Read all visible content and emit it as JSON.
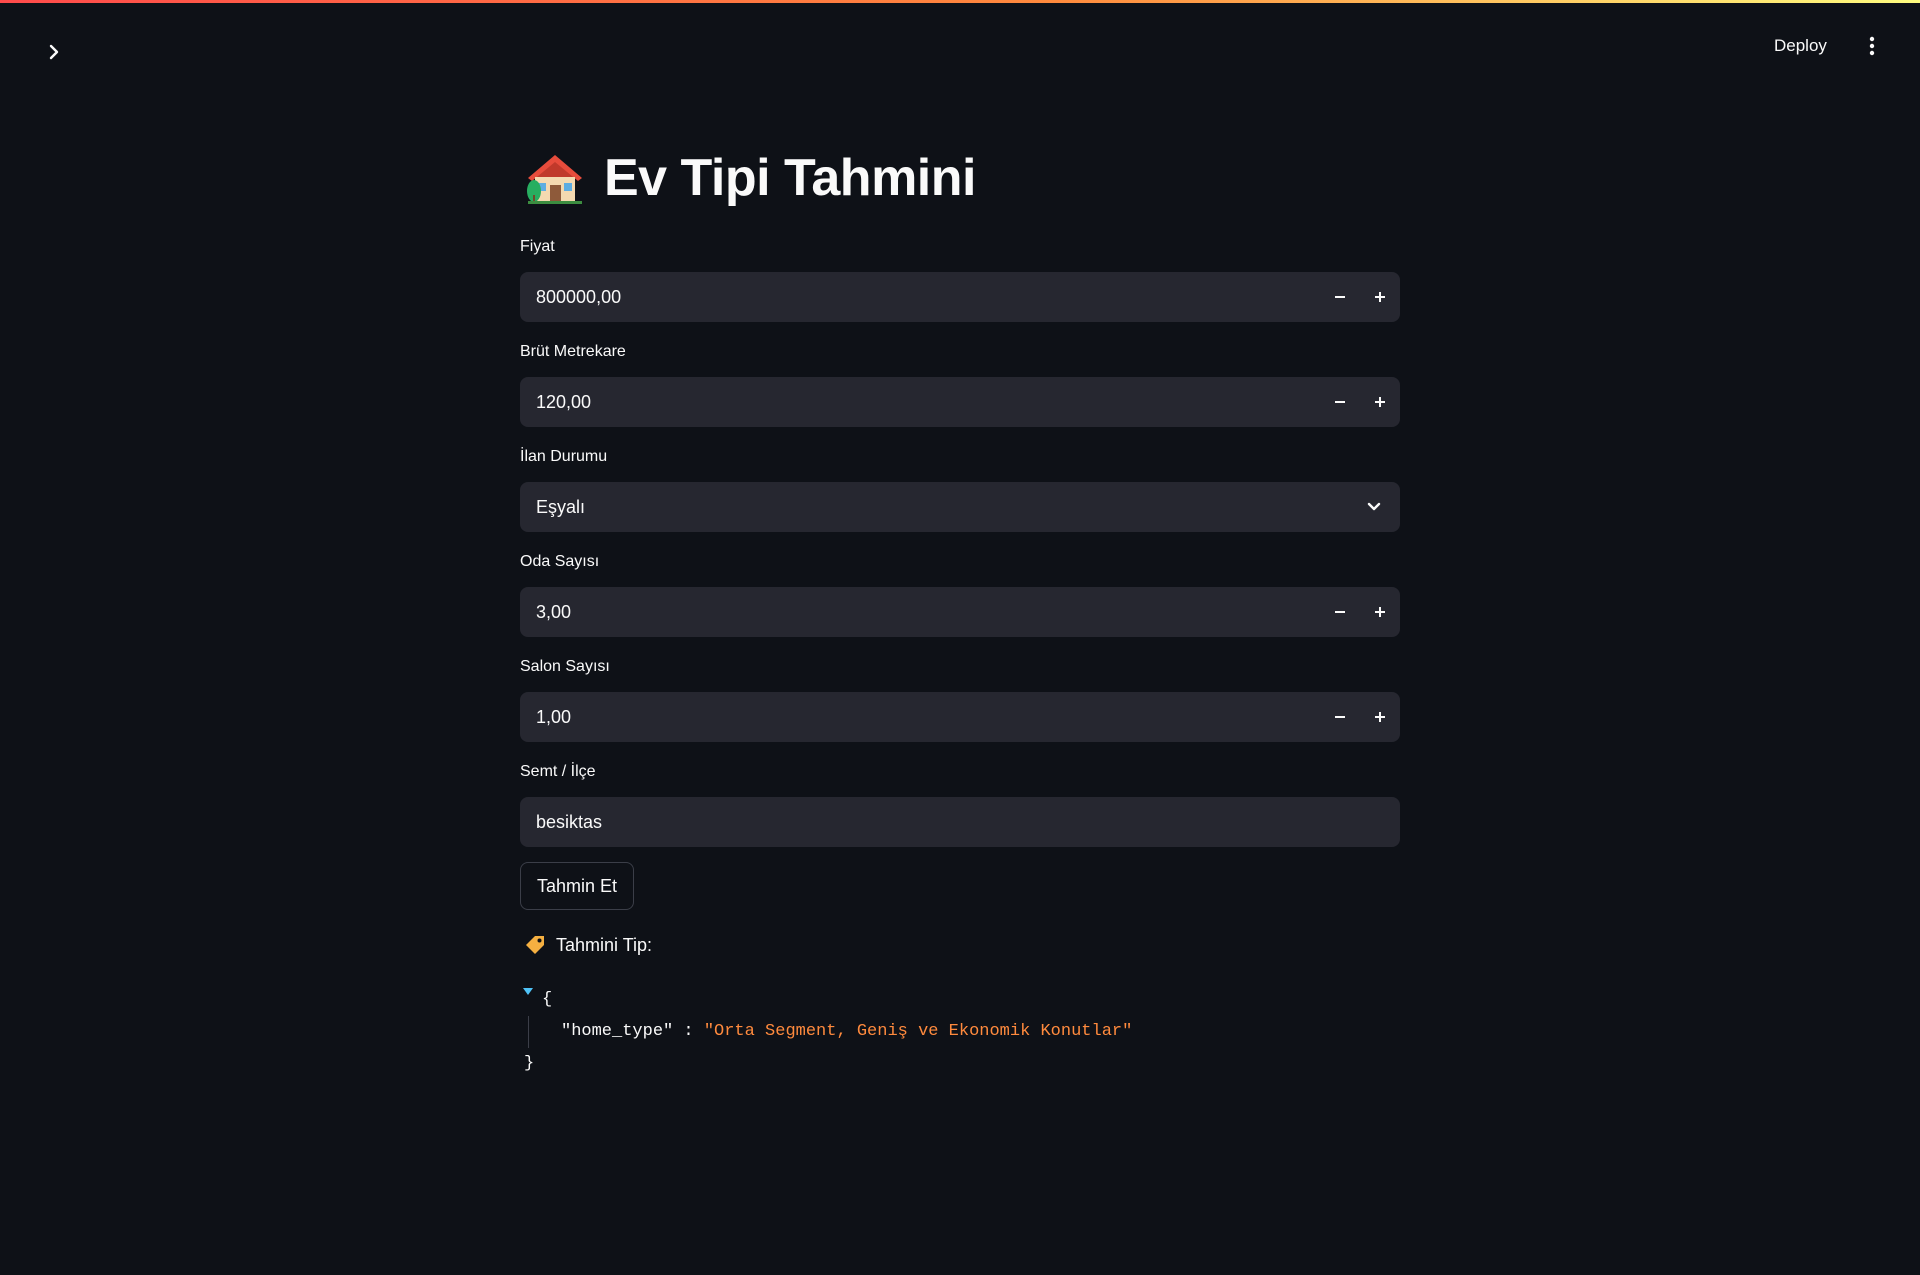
{
  "header": {
    "deploy_label": "Deploy"
  },
  "page": {
    "title": "Ev Tipi Tahmini",
    "title_icon": "house-icon"
  },
  "form": {
    "price": {
      "label": "Fiyat",
      "value": "800000,00"
    },
    "gross_sqm": {
      "label": "Brüt Metrekare",
      "value": "120,00"
    },
    "listing_status": {
      "label": "İlan Durumu",
      "value": "Eşyalı"
    },
    "rooms": {
      "label": "Oda Sayısı",
      "value": "3,00"
    },
    "halls": {
      "label": "Salon Sayısı",
      "value": "1,00"
    },
    "district": {
      "label": "Semt / İlçe",
      "value": "besiktas"
    },
    "submit_label": "Tahmin Et"
  },
  "result": {
    "label": "Tahmini Tip:",
    "label_icon": "tag-icon",
    "json_open": "{",
    "json_close": "}",
    "key": "\"home_type\"",
    "separator": ":",
    "value": "\"Orta Segment, Geniş ve Ekonomik Konutlar\""
  },
  "colors": {
    "background": "#0e1117",
    "input_bg": "#262730",
    "json_string": "#ff8a3d",
    "caret": "#4fc3f7"
  }
}
